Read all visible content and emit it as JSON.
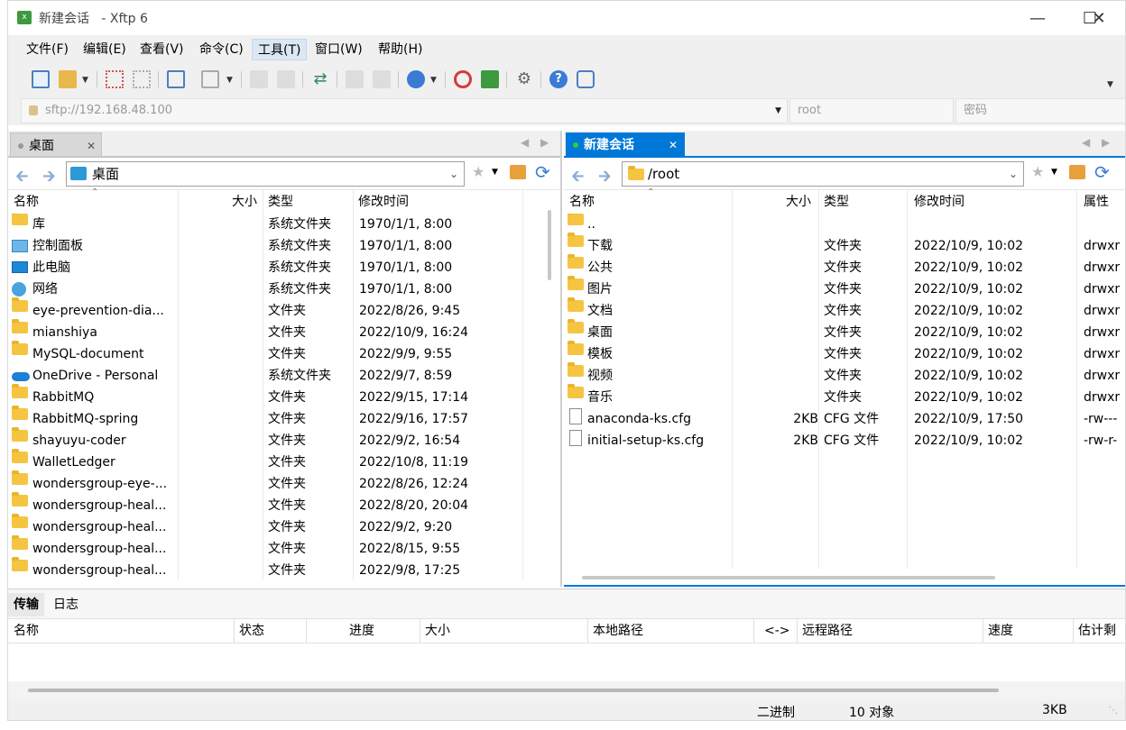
{
  "window": {
    "title": "新建会话 - Xftp 6",
    "title_session": "新建会话",
    "title_app": "- Xftp 6"
  },
  "menu": [
    "文件(F)",
    "编辑(E)",
    "查看(V)",
    "命令(C)",
    "工具(T)",
    "窗口(W)",
    "帮助(H)"
  ],
  "address": {
    "url_placeholder": "sftp://192.168.48.100",
    "user_placeholder": "root",
    "password_placeholder": "密码"
  },
  "left_pane": {
    "tab_label": "桌面",
    "path": "桌面",
    "columns": [
      "名称",
      "大小",
      "类型",
      "修改时间"
    ],
    "rows": [
      {
        "name": "库",
        "size": "",
        "type": "系统文件夹",
        "mtime": "1970/1/1, 8:00",
        "icon": "library-folder-icon"
      },
      {
        "name": "控制面板",
        "size": "",
        "type": "系统文件夹",
        "mtime": "1970/1/1, 8:00",
        "icon": "control-panel-icon"
      },
      {
        "name": "此电脑",
        "size": "",
        "type": "系统文件夹",
        "mtime": "1970/1/1, 8:00",
        "icon": "computer-icon"
      },
      {
        "name": "网络",
        "size": "",
        "type": "系统文件夹",
        "mtime": "1970/1/1, 8:00",
        "icon": "network-icon"
      },
      {
        "name": "eye-prevention-dia...",
        "size": "",
        "type": "文件夹",
        "mtime": "2022/8/26, 9:45",
        "icon": "folder-icon"
      },
      {
        "name": "mianshiya",
        "size": "",
        "type": "文件夹",
        "mtime": "2022/10/9, 16:24",
        "icon": "folder-icon"
      },
      {
        "name": "MySQL-document",
        "size": "",
        "type": "文件夹",
        "mtime": "2022/9/9, 9:55",
        "icon": "folder-icon"
      },
      {
        "name": "OneDrive - Personal",
        "size": "",
        "type": "系统文件夹",
        "mtime": "2022/9/7, 8:59",
        "icon": "onedrive-icon"
      },
      {
        "name": "RabbitMQ",
        "size": "",
        "type": "文件夹",
        "mtime": "2022/9/15, 17:14",
        "icon": "folder-icon"
      },
      {
        "name": "RabbitMQ-spring",
        "size": "",
        "type": "文件夹",
        "mtime": "2022/9/16, 17:57",
        "icon": "folder-icon"
      },
      {
        "name": "shayuyu-coder",
        "size": "",
        "type": "文件夹",
        "mtime": "2022/9/2, 16:54",
        "icon": "folder-icon"
      },
      {
        "name": "WalletLedger",
        "size": "",
        "type": "文件夹",
        "mtime": "2022/10/8, 11:19",
        "icon": "folder-icon"
      },
      {
        "name": "wondersgroup-eye-...",
        "size": "",
        "type": "文件夹",
        "mtime": "2022/8/26, 12:24",
        "icon": "folder-icon"
      },
      {
        "name": "wondersgroup-heal...",
        "size": "",
        "type": "文件夹",
        "mtime": "2022/8/20, 20:04",
        "icon": "folder-icon"
      },
      {
        "name": "wondersgroup-heal...",
        "size": "",
        "type": "文件夹",
        "mtime": "2022/9/2, 9:20",
        "icon": "folder-icon"
      },
      {
        "name": "wondersgroup-heal...",
        "size": "",
        "type": "文件夹",
        "mtime": "2022/8/15, 9:55",
        "icon": "folder-icon"
      },
      {
        "name": "wondersgroup-heal...",
        "size": "",
        "type": "文件夹",
        "mtime": "2022/9/8, 17:25",
        "icon": "folder-icon"
      }
    ]
  },
  "right_pane": {
    "tab_label": "新建会话",
    "path": "/root",
    "columns": [
      "名称",
      "大小",
      "类型",
      "修改时间",
      "属性"
    ],
    "rows": [
      {
        "name": "..",
        "size": "",
        "type": "",
        "mtime": "",
        "attr": "",
        "icon": "folder-icon"
      },
      {
        "name": "下载",
        "size": "",
        "type": "文件夹",
        "mtime": "2022/10/9, 10:02",
        "attr": "drwxr",
        "icon": "folder-icon"
      },
      {
        "name": "公共",
        "size": "",
        "type": "文件夹",
        "mtime": "2022/10/9, 10:02",
        "attr": "drwxr",
        "icon": "folder-icon"
      },
      {
        "name": "图片",
        "size": "",
        "type": "文件夹",
        "mtime": "2022/10/9, 10:02",
        "attr": "drwxr",
        "icon": "folder-icon"
      },
      {
        "name": "文档",
        "size": "",
        "type": "文件夹",
        "mtime": "2022/10/9, 10:02",
        "attr": "drwxr",
        "icon": "folder-icon"
      },
      {
        "name": "桌面",
        "size": "",
        "type": "文件夹",
        "mtime": "2022/10/9, 10:02",
        "attr": "drwxr",
        "icon": "folder-icon"
      },
      {
        "name": "模板",
        "size": "",
        "type": "文件夹",
        "mtime": "2022/10/9, 10:02",
        "attr": "drwxr",
        "icon": "folder-icon"
      },
      {
        "name": "视频",
        "size": "",
        "type": "文件夹",
        "mtime": "2022/10/9, 10:02",
        "attr": "drwxr",
        "icon": "folder-icon"
      },
      {
        "name": "音乐",
        "size": "",
        "type": "文件夹",
        "mtime": "2022/10/9, 10:02",
        "attr": "drwxr",
        "icon": "folder-icon"
      },
      {
        "name": "anaconda-ks.cfg",
        "size": "2KB",
        "type": "CFG 文件",
        "mtime": "2022/10/9, 17:50",
        "attr": "-rw---",
        "icon": "file-icon"
      },
      {
        "name": "initial-setup-ks.cfg",
        "size": "2KB",
        "type": "CFG 文件",
        "mtime": "2022/10/9, 10:02",
        "attr": "-rw-r-",
        "icon": "file-icon"
      }
    ]
  },
  "transfer": {
    "tabs": [
      "传输",
      "日志"
    ],
    "columns": [
      "名称",
      "状态",
      "进度",
      "大小",
      "本地路径",
      "<->",
      "远程路径",
      "速度",
      "估计剩"
    ]
  },
  "status": {
    "mode": "二进制",
    "objects": "10 对象",
    "size": "3KB"
  },
  "colors": {
    "accent": "#0078d7",
    "folder": "#f5c542",
    "active_tab_text": "#ffffff"
  }
}
